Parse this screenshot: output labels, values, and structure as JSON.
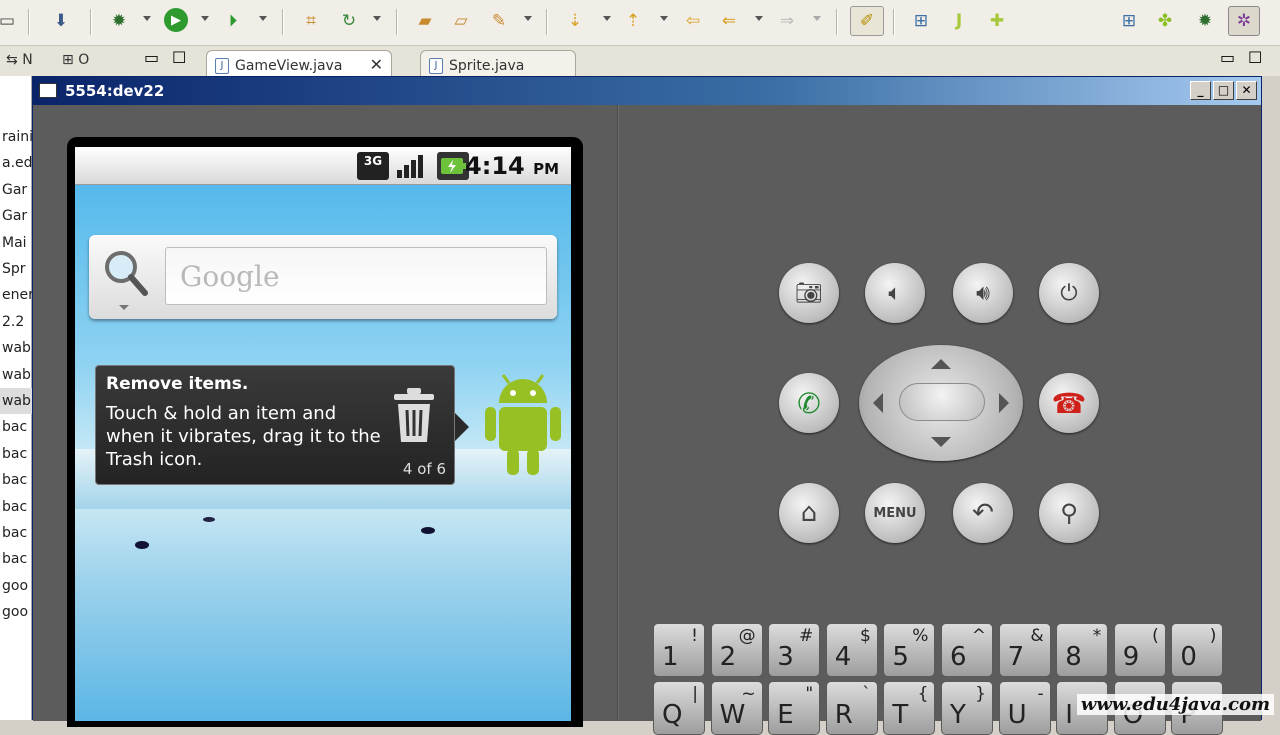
{
  "eclipse": {
    "tabs": [
      {
        "label": "GameView.java"
      },
      {
        "label": "Sprite.java"
      }
    ],
    "left_tabs": [
      {
        "label": "N"
      },
      {
        "label": "O"
      }
    ],
    "left_strip_rows": [
      "raini",
      "a.ed",
      "Gar",
      "Gar",
      "Mai",
      "Spr",
      "ener",
      "2.2",
      "wab",
      "wab",
      "wab",
      "bac",
      "bac",
      "bac",
      "bac",
      "bac",
      "bac",
      "goo",
      "goo"
    ]
  },
  "emulator": {
    "window_title": "5554:dev22",
    "clock_time": "4:14",
    "clock_ampm": "PM",
    "network": "3G",
    "search_placeholder": "Google",
    "tip": {
      "title": "Remove items.",
      "body": "Touch & hold an item and when it vibrates, drag it to the Trash icon.",
      "count": "4 of 6"
    },
    "menu_label": "MENU",
    "keyboard_row1": [
      {
        "main": "1",
        "sub": "!"
      },
      {
        "main": "2",
        "sub": "@"
      },
      {
        "main": "3",
        "sub": "#"
      },
      {
        "main": "4",
        "sub": "$"
      },
      {
        "main": "5",
        "sub": "%"
      },
      {
        "main": "6",
        "sub": "^"
      },
      {
        "main": "7",
        "sub": "&"
      },
      {
        "main": "8",
        "sub": "*"
      },
      {
        "main": "9",
        "sub": "("
      },
      {
        "main": "0",
        "sub": ")"
      }
    ],
    "keyboard_row2": [
      {
        "main": "Q",
        "sub": "|"
      },
      {
        "main": "W",
        "sub": "~"
      },
      {
        "main": "E",
        "sub": "\""
      },
      {
        "main": "R",
        "sub": "`"
      },
      {
        "main": "T",
        "sub": "{"
      },
      {
        "main": "Y",
        "sub": "}"
      },
      {
        "main": "U",
        "sub": "-"
      },
      {
        "main": "I",
        "sub": ""
      },
      {
        "main": "O",
        "sub": ""
      },
      {
        "main": "P",
        "sub": ""
      }
    ]
  },
  "watermark": "www.edu4java.com"
}
